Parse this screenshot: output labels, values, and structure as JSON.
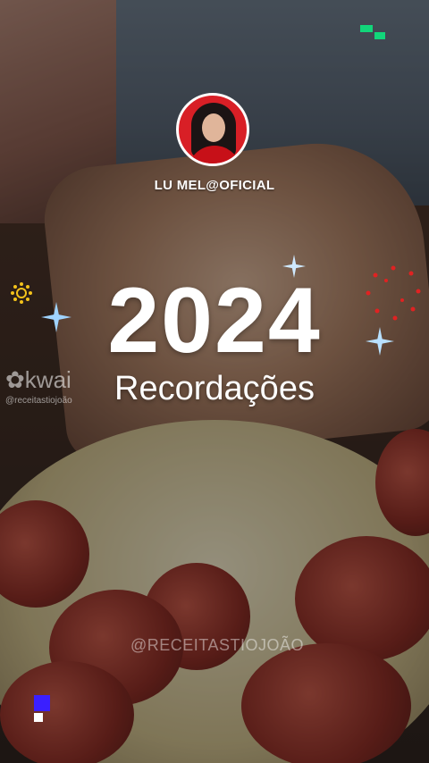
{
  "profile": {
    "username": "LU MEL@OFICIAL"
  },
  "hero": {
    "year": "2024",
    "subtitle": "Recordações"
  },
  "watermarks": {
    "brand": "kwai",
    "brand_handle": "@receitastiojoão",
    "bottom_handle": "@RECEITASTIOJOÃO"
  },
  "colors": {
    "accent_red": "#d81f26",
    "text": "#ffffff",
    "sparkle_blue": "#9fd3ff",
    "sun_yellow": "#f3c21b",
    "dot_red": "#e02222",
    "corner_green": "#12d67a",
    "corner_blue": "#3a1fff"
  },
  "icons": [
    "sun-icon",
    "sparkle-icon",
    "red-dots-ring-icon",
    "kwai-logo-icon"
  ]
}
